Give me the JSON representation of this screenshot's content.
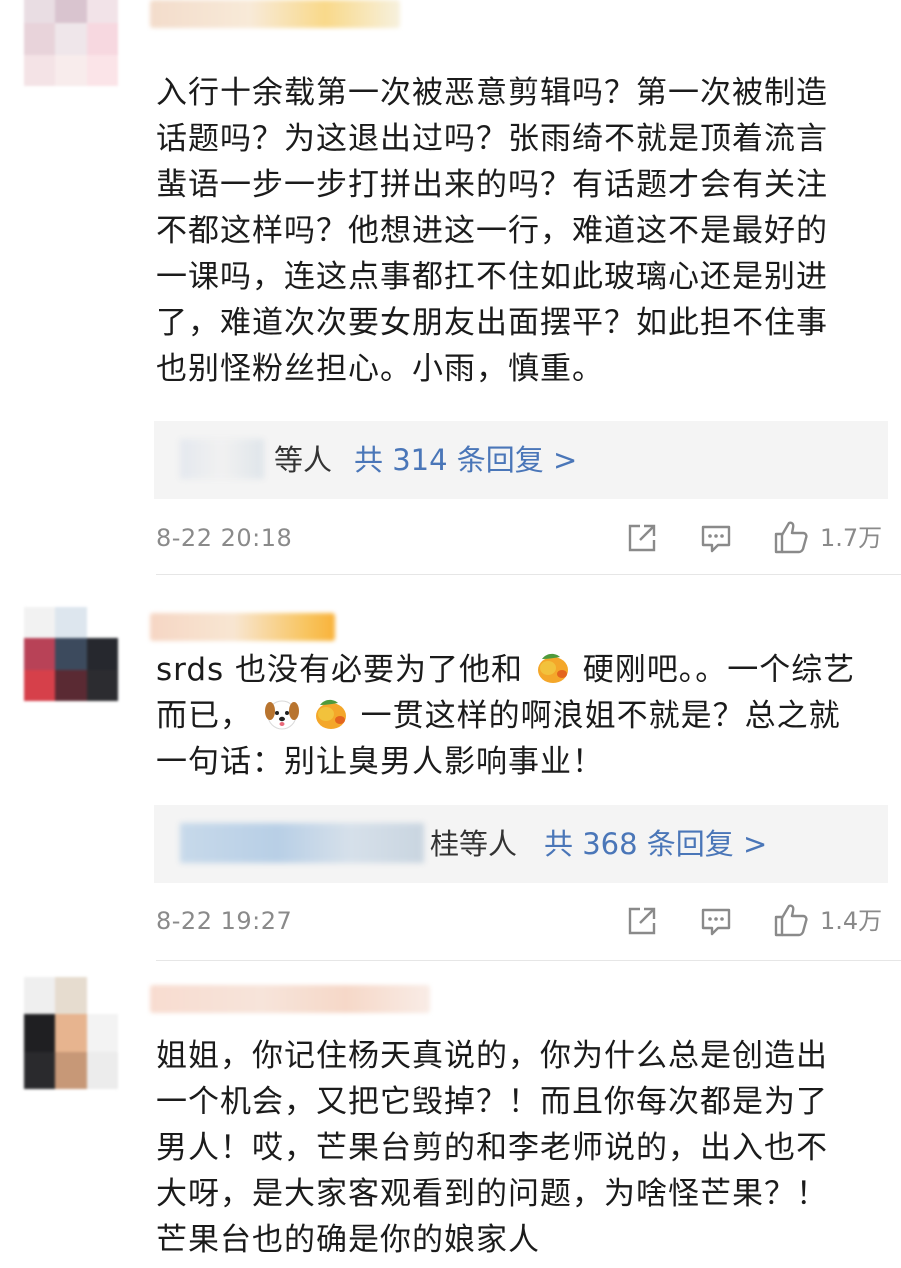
{
  "comments": [
    {
      "text_lines": [
        "入行十余载第一次被恶意剪辑吗？第一次被制造",
        "话题吗？为这退出过吗？张雨绮不就是顶着流言",
        "蜚语一步一步打拼出来的吗？有话题才会有关注",
        "不都这样吗？他想进这一行，难道这不是最好的",
        "一课吗，连这点事都扛不住如此玻璃心还是别进",
        "了，难道次次要女朋友出面摆平？如此担不住事",
        "也别怪粉丝担心。小雨，慎重。"
      ],
      "replies_who": "等人",
      "replies_link": "共 314 条回复 >",
      "timestamp": "8-22 20:18",
      "likes": "1.7万"
    },
    {
      "text_parts": {
        "line1a": "srds 也没有必要为了他和",
        "line1b": "硬刚吧。。一个综艺",
        "line2a": "而已，",
        "line2b": "一贯这样的啊浪姐不就是？总之就",
        "line3": "一句话：别让臭男人影响事业！"
      },
      "replies_who": "桂等人",
      "replies_link": "共 368 条回复 >",
      "timestamp": "8-22 19:27",
      "likes": "1.4万"
    },
    {
      "text_lines": [
        "姐姐，你记住杨天真说的，你为什么总是创造出",
        "一个机会，又把它毁掉？！而且你每次都是为了",
        "男人！哎，芒果台剪的和李老师说的，出入也不",
        "大呀，是大家客观看到的问题，为啥怪芒果？！",
        "芒果台也的确是你的娘家人"
      ]
    }
  ],
  "icons": {
    "share": "share-icon",
    "comment": "comment-icon",
    "like": "thumbs-up-icon",
    "mango": "mango-emoji",
    "dog": "dog-emoji"
  },
  "colors": {
    "link": "#4a76b8",
    "meta": "#8a8a8a",
    "reply_bg": "#f4f4f4"
  }
}
